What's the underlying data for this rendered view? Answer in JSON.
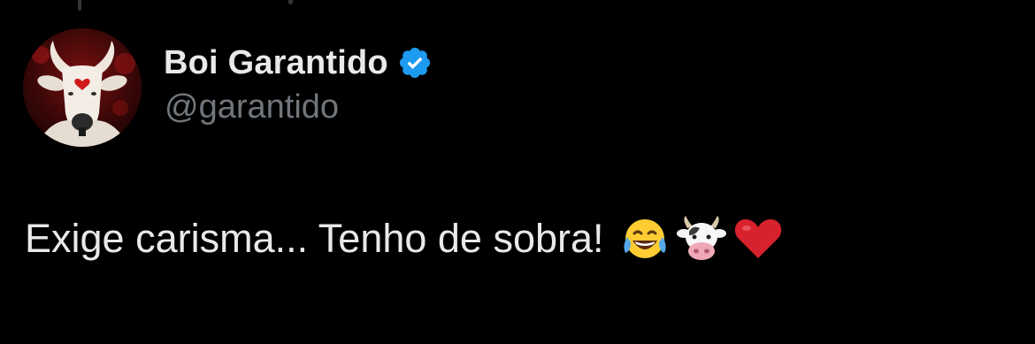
{
  "author": {
    "display_name": "Boi Garantido",
    "handle": "@garantido",
    "verified": true,
    "verified_color": "#1d9bf0"
  },
  "tweet": {
    "text": "Exige carisma... Tenho de sobra!",
    "emojis": [
      "face-with-tears-of-joy",
      "cow-face",
      "red-heart"
    ]
  },
  "colors": {
    "background": "#000000",
    "primary_text": "#e7e9ea",
    "secondary_text": "#71767b"
  }
}
